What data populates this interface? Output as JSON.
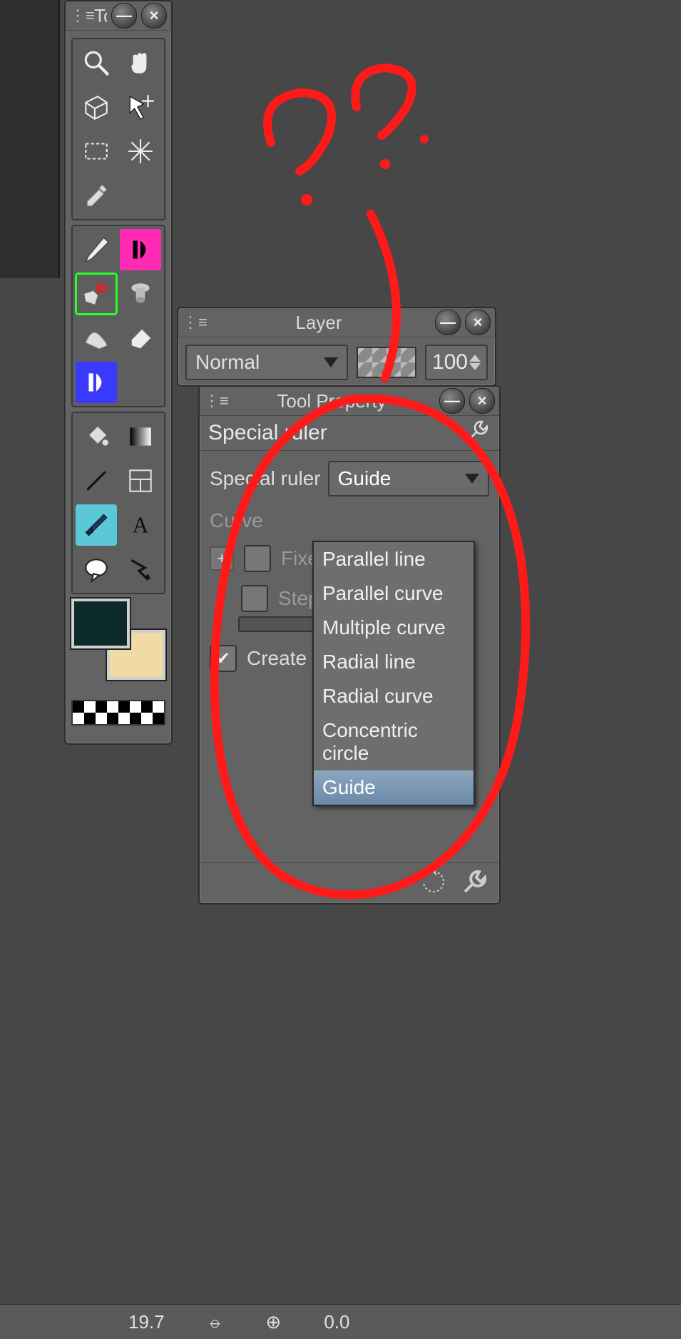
{
  "tool_palette": {
    "title": "To",
    "tools": [
      [
        "zoom",
        "hand"
      ],
      [
        "rotate-3d",
        "move"
      ],
      [
        "marquee",
        "wand"
      ],
      [
        "eyedropper",
        null
      ],
      [
        "pen",
        "frame-play-pink"
      ],
      [
        "brush",
        "airbrush"
      ],
      [
        "blend",
        "eraser"
      ],
      [
        "frame-play-blue",
        null
      ],
      [
        "fill",
        "gradient"
      ],
      [
        "line",
        "panel-divide"
      ],
      [
        "ruler",
        "text"
      ],
      [
        "balloon",
        "correct-line"
      ]
    ],
    "fg_color": "#0d2a2a",
    "bg_color": "#f0dba4"
  },
  "layer_panel": {
    "title": "Layer",
    "blend_mode": "Normal",
    "opacity": "100"
  },
  "tool_property": {
    "title": "Tool Property",
    "subtool": "Special ruler",
    "special_ruler_label": "Special ruler",
    "special_ruler_value": "Guide",
    "curve_label": "Curve",
    "fixed_label": "Fixed",
    "step_label": "Step o",
    "create_label": "Create",
    "create_checked": true,
    "menu": [
      "Parallel line",
      "Parallel curve",
      "Multiple curve",
      "Radial line",
      "Radial curve",
      "Concentric circle",
      "Guide"
    ],
    "menu_selected": "Guide"
  },
  "status": {
    "zoom": "19.7",
    "value": "0.0"
  },
  "annotation": {
    "text": "??"
  }
}
